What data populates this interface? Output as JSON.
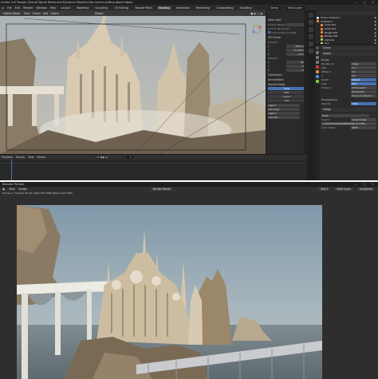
{
  "blender": {
    "title": "render 2.8 Temple (Sacral Naval Items and Dynamic Models) Dec-scene-editing Ideal+Ideal)",
    "menu": [
      "File",
      "Edit",
      "Render",
      "Window",
      "Help"
    ],
    "workspaces": [
      "Layout",
      "Modeling",
      "Sculpting",
      "UV Editing",
      "Texture Paint",
      "Shading",
      "Animation",
      "Rendering",
      "Compositing",
      "Scripting"
    ],
    "active_workspace": "Shading",
    "scene_label": "Scene",
    "viewlayer_label": "View Layer",
    "viewport_header": {
      "mode": "Object Mode",
      "items": [
        "View",
        "Select",
        "Add",
        "Object"
      ],
      "orientation": "Global"
    },
    "npanel": {
      "view_lock_label": "View Lock",
      "lock_to_object": "Lock to Object",
      "lock_to_cursor": "Lock to 3D Cursor",
      "lock_camera": "Lock Camera to View",
      "cursor_title": "3D Cursor",
      "location_label": "Location",
      "loc_x": "200.2 m",
      "loc_y": "31.325 m",
      "loc_z": "0.3 m",
      "rotation_label": "Rotation",
      "rot_x": "90°",
      "rot_y": "0°",
      "rot_z": "-0°",
      "collections_label": "Collections",
      "annotations_label": "Annotations",
      "stored_views_label": "Stored Views",
      "btn_view": "View",
      "btn_pov": "POV",
      "btn_layers": "Layers",
      "btn_list": "List",
      "cam_label_1": "angle 1",
      "cam_label_2": "side angle",
      "cam_label_3": "angle 3",
      "cam_label_4": "overview"
    },
    "outliner": {
      "rows": [
        {
          "name": "Scene Collection",
          "color": "#d9d9d9"
        },
        {
          "name": "Collection",
          "color": "#ff8a3a"
        },
        {
          "name": "Cube.011",
          "color": "#ff8a3a"
        },
        {
          "name": "Cube.012",
          "color": "#ff8a3a"
        },
        {
          "name": "Bridge.001",
          "color": "#ff8a3a"
        },
        {
          "name": "Bridge.002",
          "color": "#ff8a3a"
        },
        {
          "name": "Camera",
          "color": "#9fd36b"
        },
        {
          "name": "Sun",
          "color": "#e8d36a"
        }
      ]
    },
    "properties": {
      "header": "Scene",
      "tab_label": "Empty",
      "empty_section": "Empty",
      "display_as_label": "Display As",
      "display_as_value": "Image",
      "size_label": "Size",
      "size_value": "5 m",
      "offset_x_label": "Offset X",
      "offset_x_value": "0.5",
      "offset_y_label": "Y",
      "offset_y_value": "0.5",
      "depth_label": "Depth",
      "depth_value": "Default",
      "side_label": "Side",
      "side_value": "Both",
      "show_in_label": "Show in",
      "orthographic": "Orthographic",
      "perspective": "Perspective",
      "only_axis": "Only Axis Aligned",
      "transparency": "Transparency",
      "opacity_label": "Opacity",
      "opacity_value": "0.500",
      "image_section": "Image",
      "image_name": "Temp",
      "source_label": "Source",
      "source_value": "Single Image",
      "file_path": "//_WWW BLEND-BLENDERING-CLOUDS_...",
      "color_space_label": "Color Space",
      "color_space_value": "sRGB"
    },
    "timeline": {
      "items": [
        "Playback",
        "Keying",
        "View",
        "Marker"
      ],
      "frame": "1"
    }
  },
  "render": {
    "title": "Blender Render",
    "header_items": [
      "View",
      "Image"
    ],
    "slot": "Render Result",
    "right_items": [
      "Slot 1",
      "View Layer",
      "Combined"
    ],
    "stats": "Frame:1 | Time:01:52.16 | Mem:857.05M (Peak 1115.31M)"
  }
}
